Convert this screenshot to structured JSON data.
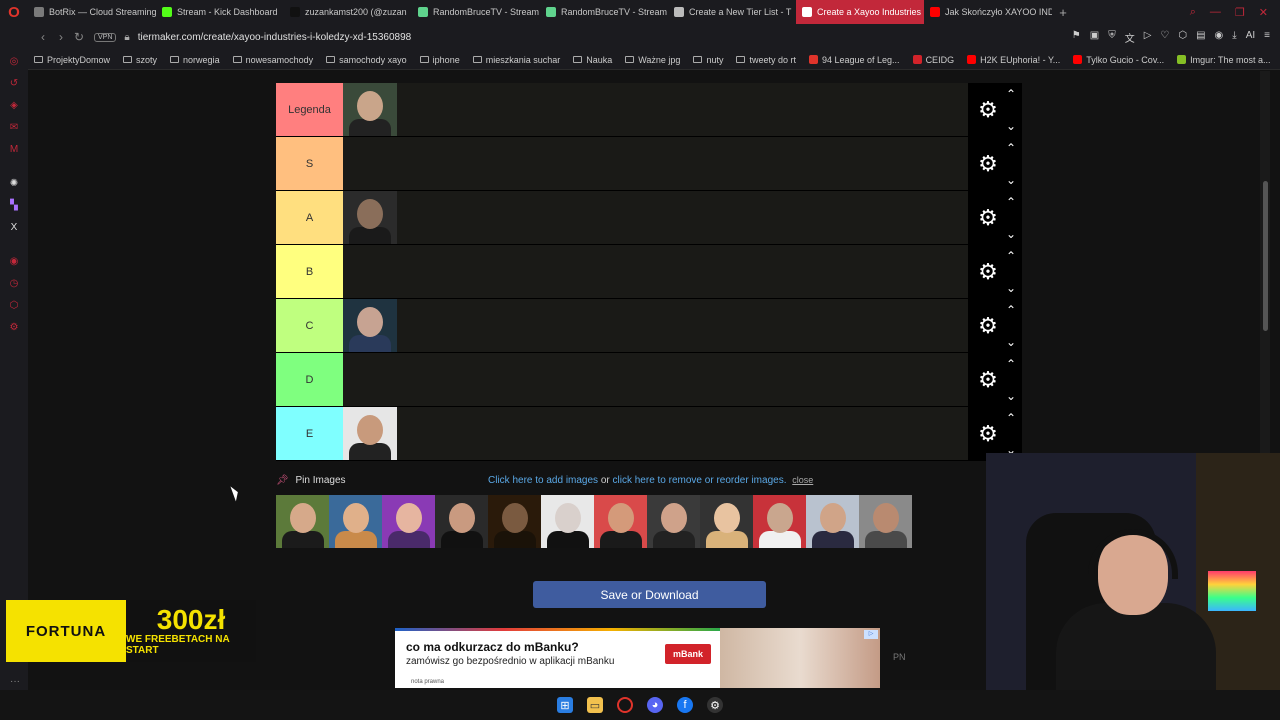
{
  "browser": {
    "tabs": [
      {
        "label": "BotRix — Cloud Streaming",
        "color": "#7a7a7a",
        "active": false
      },
      {
        "label": "Stream - Kick Dashboard",
        "color": "#53fc18",
        "active": false
      },
      {
        "label": "zuzankamst200 (@zuzan",
        "color": "#111111",
        "active": false
      },
      {
        "label": "RandomBruceTV - Stream",
        "color": "#5fd38d",
        "active": false
      },
      {
        "label": "RandomBruceTV - Stream",
        "color": "#5fd38d",
        "active": false
      },
      {
        "label": "Create a New Tier List - T",
        "color": "#bbbbbb",
        "active": false
      },
      {
        "label": "Create a Xayoo Industries",
        "color": "#ffffff",
        "active": true
      },
      {
        "label": "Jak Skończyło XAYOO IND",
        "color": "#ff0000",
        "active": false
      }
    ],
    "vpn_label": "VPN",
    "url": "tiermaker.com/create/xayoo-industries-i-koledzy-xd-15360898",
    "ai_label": "AI",
    "bookmarks": [
      {
        "label": "ProjektyDomow",
        "type": "folder"
      },
      {
        "label": "szoty",
        "type": "folder"
      },
      {
        "label": "norwegia",
        "type": "folder"
      },
      {
        "label": "nowesamochody",
        "type": "folder"
      },
      {
        "label": "samochody xayo",
        "type": "folder"
      },
      {
        "label": "iphone",
        "type": "folder"
      },
      {
        "label": "mieszkania suchar",
        "type": "folder"
      },
      {
        "label": "Nauka",
        "type": "folder"
      },
      {
        "label": "Ważne jpg",
        "type": "folder"
      },
      {
        "label": "nuty",
        "type": "folder"
      },
      {
        "label": "tweety do rt",
        "type": "folder"
      },
      {
        "label": "94 League of Leg...",
        "type": "site",
        "color": "#e0342b"
      },
      {
        "label": "CEIDG",
        "type": "site",
        "color": "#d2232a"
      },
      {
        "label": "H2K EUphoria! - Y...",
        "type": "site",
        "color": "#ff0000"
      },
      {
        "label": "Tylko Gucio - Cov...",
        "type": "site",
        "color": "#ff0000"
      },
      {
        "label": "Imgur: The most a...",
        "type": "site",
        "color": "#85bf25"
      }
    ]
  },
  "tiers": [
    {
      "label": "Legenda",
      "color": "#ff7f7f",
      "items": [
        {
          "skin": "#c9a58a",
          "shirt": "#222222",
          "bg": "#3a4a3a"
        }
      ]
    },
    {
      "label": "S",
      "color": "#ffbf7f",
      "items": []
    },
    {
      "label": "A",
      "color": "#ffdf7f",
      "items": [
        {
          "skin": "#8a6e5a",
          "shirt": "#1a1a1a",
          "bg": "#2b2b2b"
        }
      ]
    },
    {
      "label": "B",
      "color": "#ffff7f",
      "items": []
    },
    {
      "label": "C",
      "color": "#bfff7f",
      "items": [
        {
          "skin": "#c7a392",
          "shirt": "#2a3a5a",
          "bg": "#1f3340"
        }
      ]
    },
    {
      "label": "D",
      "color": "#7fff7f",
      "items": []
    },
    {
      "label": "E",
      "color": "#7fffff",
      "items": [
        {
          "skin": "#c89a7c",
          "shirt": "#222222",
          "bg": "#e6e6e6"
        }
      ]
    }
  ],
  "pin_section": {
    "label": "Pin Images",
    "text_link_add": "Click here to add images",
    "text_or": " or ",
    "text_link_remove": "click here to remove or reorder images.",
    "close": "close"
  },
  "pool_items": [
    {
      "skin": "#d6a98a",
      "shirt": "#1b1b1b",
      "bg": "#5c7a3a"
    },
    {
      "skin": "#e0b08a",
      "shirt": "#c98a4a",
      "bg": "#3a6a9a"
    },
    {
      "skin": "#e6b5a0",
      "shirt": "#4a2a6a",
      "bg": "#8a3ab5"
    },
    {
      "skin": "#c99a80",
      "shirt": "#111111",
      "bg": "#2a2a2a"
    },
    {
      "skin": "#7a5a40",
      "shirt": "#1a1208",
      "bg": "#2a1a0a"
    },
    {
      "skin": "#d9d0cc",
      "shirt": "#111111",
      "bg": "#e8e8e8"
    },
    {
      "skin": "#d49a7a",
      "shirt": "#1a1a1a",
      "bg": "#d94a4a"
    },
    {
      "skin": "#cfa28a",
      "shirt": "#222222",
      "bg": "#3a3a3a"
    },
    {
      "skin": "#e8c3a0",
      "shirt": "#d9b27a",
      "bg": "#333333"
    },
    {
      "skin": "#c9a68e",
      "shirt": "#f0f0f0",
      "bg": "#c8323a"
    },
    {
      "skin": "#d0a488",
      "shirt": "#2a2a40",
      "bg": "#b9c2cf"
    },
    {
      "skin": "#b98a70",
      "shirt": "#4a4a4a",
      "bg": "#8a8a8a"
    }
  ],
  "save_button": "Save or Download",
  "fortuna_ad": {
    "brand": "FORTUNA",
    "amount": "300zł",
    "tagline": "WE FREEBETACH NA START"
  },
  "mbank_ad": {
    "title": "co ma odkurzacz do mBanku?",
    "subtitle": "zamówisz go bezpośrednio w aplikacji mBanku",
    "note": "nota prawna",
    "logo": "mBank"
  },
  "pn_label": "PN",
  "colors": {
    "accent": "#c2283a",
    "button": "#3f5c9f",
    "link": "#5aa8e6"
  }
}
